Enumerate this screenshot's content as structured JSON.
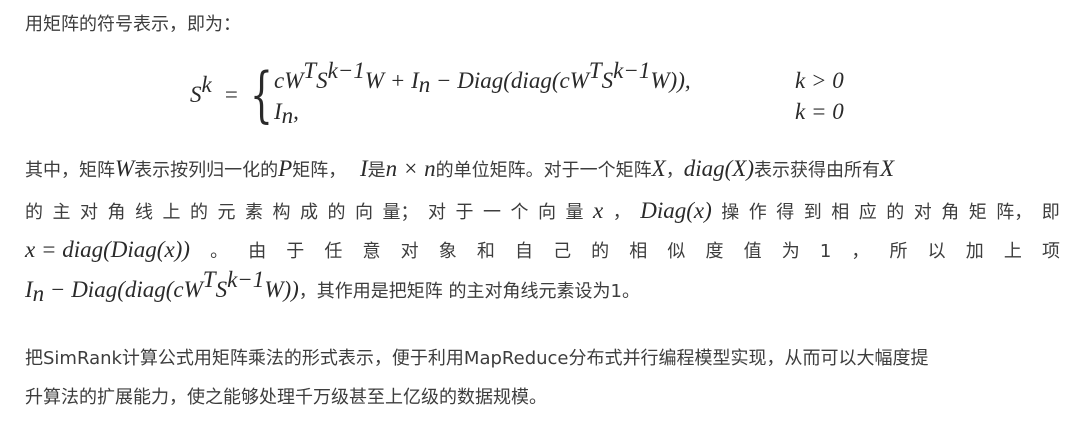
{
  "intro": "用矩阵的符号表示，即为：",
  "formula": {
    "lhs_base": "S",
    "lhs_exp": "k",
    "equals": "=",
    "case1_expr": {
      "p1": "cW",
      "p1_sup": "T",
      "p2": "S",
      "p2_sup": "k−1",
      "p3": "W + I",
      "p3_sub": "n",
      "p4": " − Diag(diag(cW",
      "p4_sup": "T",
      "p5": "S",
      "p5_sup": "k−1",
      "p6": "W)),"
    },
    "case1_cond": "k > 0",
    "case2_base": "I",
    "case2_sub": "n",
    "case2_tail": ",",
    "case2_cond": "k = 0"
  },
  "para1": {
    "l1_a": "其中，矩阵",
    "l1_W": "W",
    "l1_b": "表示按列归一化的",
    "l1_P": "P",
    "l1_c": "矩阵，",
    "l1_I": "I",
    "l1_d": "是",
    "l1_nn": "n × n",
    "l1_e": "的单位矩阵。对于一个矩阵",
    "l1_X": "X",
    "l1_f": "，",
    "l1_diagX": "diag(X)",
    "l1_g": "表示获得由所有",
    "l1_X2": "X",
    "l2_tokens": [
      "的",
      "主",
      "对",
      "角",
      "线",
      "上",
      "的",
      "元",
      "素",
      "构",
      "成",
      "的",
      "向",
      "量；",
      "对",
      "于",
      "一",
      "个",
      "向",
      "量"
    ],
    "l2_x": "x",
    "l2_comma": "，",
    "l2_Diagx": "Diag(x)",
    "l2_tokens2": [
      "操",
      "作",
      "得",
      "到",
      "相",
      "应",
      "的",
      "对",
      "角",
      "矩",
      "阵，",
      "即"
    ],
    "l3_math": "x = diag(Diag(x))",
    "l3_tokens": [
      "。",
      "由",
      "于",
      "任",
      "意",
      "对",
      "象",
      "和",
      "自",
      "己",
      "的",
      "相",
      "似",
      "度",
      "值",
      "为",
      "1",
      "，",
      "所",
      "以",
      "加",
      "上",
      "项"
    ],
    "l4_a": "I",
    "l4_sub": "n",
    "l4_b": " − Diag(diag(cW",
    "l4_sup1": "T",
    "l4_c": "S",
    "l4_sup2": "k−1",
    "l4_d": "W))",
    "l4_text": "，其作用是把矩阵 的主对角线元素设为1。"
  },
  "para2": {
    "l1": "把SimRank计算公式用矩阵乘法的形式表示，便于利用MapReduce分布式并行编程模型实现，从而可以大幅度提",
    "l2": "升算法的扩展能力，使之能够处理千万级甚至上亿级的数据规模。"
  }
}
